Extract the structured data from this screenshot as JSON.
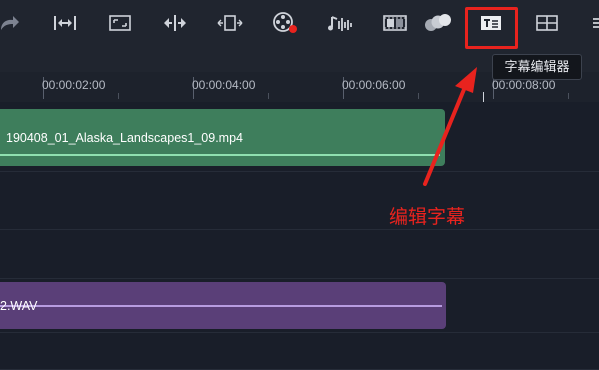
{
  "toolbar": {
    "icons": [
      "redo-icon",
      "fit-span-icon",
      "crop-icon",
      "split-icon",
      "expand-clip-icon",
      "record-media-icon",
      "audio-wave-icon",
      "multicam-icon",
      "color-balls-icon",
      "subtitle-editor-icon",
      "multi-view-icon",
      "more-menu-icon"
    ]
  },
  "tooltip": {
    "text": "字幕编辑器"
  },
  "timeline": {
    "ticks": [
      "00:00:02:00",
      "00:00:04:00",
      "00:00:06:00",
      "00:00:08:00"
    ]
  },
  "clips": {
    "video_name": "190408_01_Alaska_Landscapes1_09.mp4",
    "audio_name": "2.WAV"
  },
  "annotation": {
    "text": "编辑字幕"
  },
  "colors": {
    "annotation_red": "#e8231e",
    "video_clip": "#3e7e5c",
    "audio_clip": "#5a3f78"
  }
}
